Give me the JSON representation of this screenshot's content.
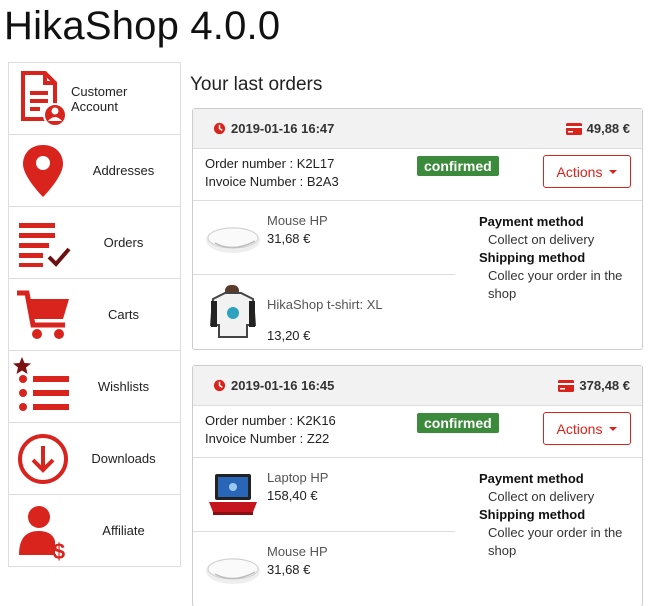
{
  "page": {
    "title": "HikaShop 4.0.0"
  },
  "menu": {
    "items": [
      {
        "label": "Customer Account",
        "icon": "customer-account-icon"
      },
      {
        "label": "Addresses",
        "icon": "map-pin-icon"
      },
      {
        "label": "Orders",
        "icon": "orders-list-icon"
      },
      {
        "label": "Carts",
        "icon": "cart-icon"
      },
      {
        "label": "Wishlists",
        "icon": "wishlist-icon"
      },
      {
        "label": "Downloads",
        "icon": "download-icon"
      },
      {
        "label": "Affiliate",
        "icon": "affiliate-icon"
      }
    ]
  },
  "main": {
    "section_title": "Your last orders"
  },
  "orders": [
    {
      "date": "2019-01-16 16:47",
      "total": "49,88 €",
      "order_number": "Order number : K2L17",
      "invoice_number": "Invoice Number : B2A3",
      "status": "confirmed",
      "actions_label": "Actions",
      "products": [
        {
          "name": "Mouse HP",
          "price": "31,68 €",
          "image": "mouse-image"
        },
        {
          "name": "HikaShop t-shirt: XL",
          "price": "13,20 €",
          "image": "tshirt-image"
        }
      ],
      "payment_title": "Payment method",
      "payment_value": "Collect on delivery",
      "shipping_title": "Shipping method",
      "shipping_value": "Collec your order in the shop"
    },
    {
      "date": "2019-01-16 16:45",
      "total": "378,48 €",
      "order_number": "Order number : K2K16",
      "invoice_number": "Invoice Number : Z22",
      "status": "confirmed",
      "actions_label": "Actions",
      "products": [
        {
          "name": "Laptop HP",
          "price": "158,40 €",
          "image": "laptop-image"
        },
        {
          "name": "Mouse HP",
          "price": "31,68 €",
          "image": "mouse-image"
        }
      ],
      "payment_title": "Payment method",
      "payment_value": "Collect on delivery",
      "shipping_title": "Shipping method",
      "shipping_value": "Collec your order in the shop"
    }
  ],
  "colors": {
    "accent": "#d9231d",
    "status_confirmed": "#3c8a3c",
    "header_bg": "#f2f2f2"
  }
}
